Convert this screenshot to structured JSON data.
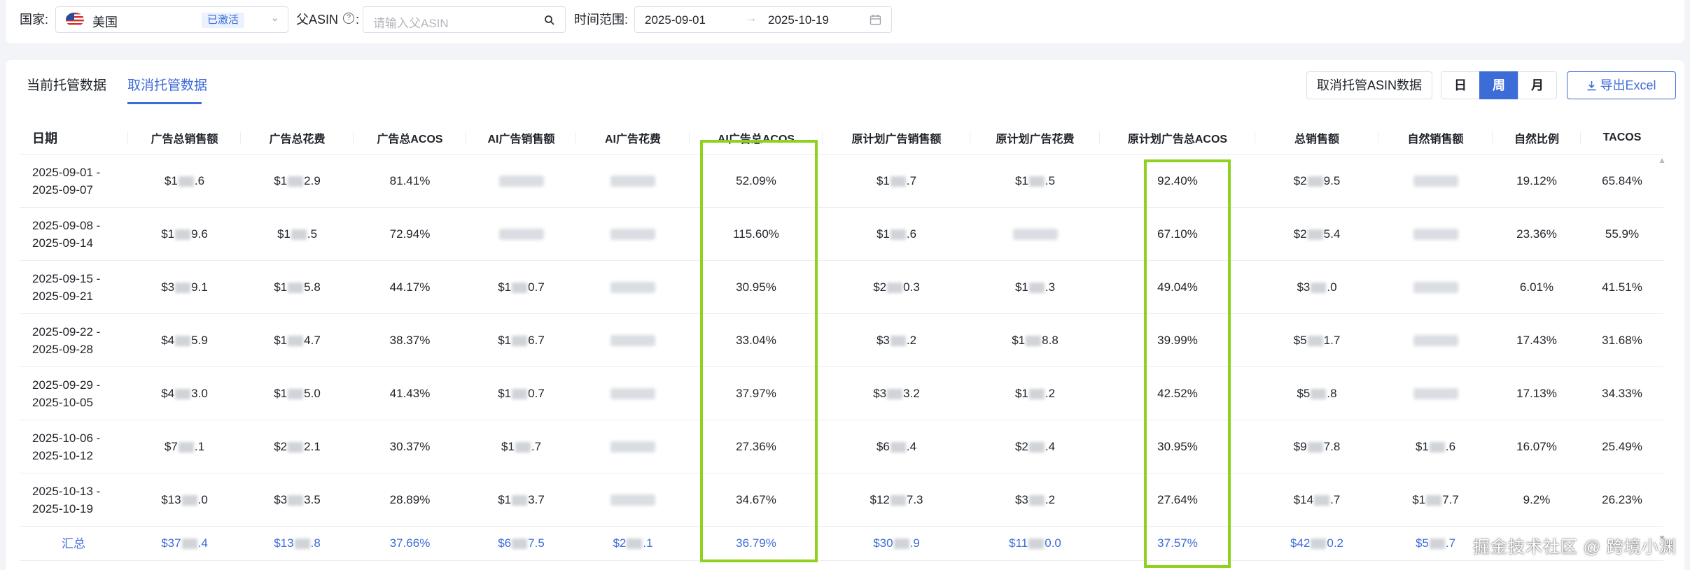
{
  "filters": {
    "country_label": "国家:",
    "country_value": "美国",
    "country_badge": "已激活",
    "parent_asin_label": "父ASIN",
    "parent_asin_placeholder": "请输入父ASIN",
    "date_range_label": "时间范围:",
    "date_start": "2025-09-01",
    "date_end": "2025-10-19"
  },
  "tabs": [
    "当前托管数据",
    "取消托管数据"
  ],
  "actions": {
    "cancel_asin_data": "取消托管ASIN数据",
    "period_day": "日",
    "period_week": "周",
    "period_month": "月",
    "export": "导出Excel"
  },
  "table": {
    "columns": [
      "日期",
      "广告总销售额",
      "广告总花费",
      "广告总ACOS",
      "AI广告销售额",
      "AI广告花费",
      "AI广告总ACOS",
      "原计划广告销售额",
      "原计划广告花费",
      "原计划广告总ACOS",
      "总销售额",
      "自然销售额",
      "自然比例",
      "TACOS"
    ],
    "rows": [
      {
        "date1": "2025-09-01 -",
        "date2": "2025-09-07",
        "c1a": "$1",
        "c1b": ".6",
        "c2a": "$1",
        "c2b": "2.9",
        "acos": "81.41%",
        "c4a": "",
        "c4b": "",
        "c5a": "",
        "c5b": "",
        "ai_acos": "52.09%",
        "c7a": "$1",
        "c7b": ".7",
        "c8a": "$1",
        "c8b": ".5",
        "orig_acos": "92.40%",
        "c10a": "$2",
        "c10b": "9.5",
        "c11a": "",
        "c11b": "",
        "ratio": "19.12%",
        "tacos": "65.84%"
      },
      {
        "date1": "2025-09-08 -",
        "date2": "2025-09-14",
        "c1a": "$1",
        "c1b": "9.6",
        "c2a": "$1",
        "c2b": ".5",
        "acos": "72.94%",
        "c4a": "",
        "c4b": "",
        "c5a": "",
        "c5b": "",
        "ai_acos": "115.60%",
        "c7a": "$1",
        "c7b": ".6",
        "c8a": "",
        "c8b": "",
        "orig_acos": "67.10%",
        "c10a": "$2",
        "c10b": "5.4",
        "c11a": "",
        "c11b": "",
        "ratio": "23.36%",
        "tacos": "55.9%"
      },
      {
        "date1": "2025-09-15 -",
        "date2": "2025-09-21",
        "c1a": "$3",
        "c1b": "9.1",
        "c2a": "$1",
        "c2b": "5.8",
        "acos": "44.17%",
        "c4a": "$1",
        "c4b": "0.7",
        "c5a": "",
        "c5b": "",
        "ai_acos": "30.95%",
        "c7a": "$2",
        "c7b": "0.3",
        "c8a": "$1",
        "c8b": ".3",
        "orig_acos": "49.04%",
        "c10a": "$3",
        "c10b": ".0",
        "c11a": "",
        "c11b": "",
        "ratio": "6.01%",
        "tacos": "41.51%"
      },
      {
        "date1": "2025-09-22 -",
        "date2": "2025-09-28",
        "c1a": "$4",
        "c1b": "5.9",
        "c2a": "$1",
        "c2b": "4.7",
        "acos": "38.37%",
        "c4a": "$1",
        "c4b": "6.7",
        "c5a": "",
        "c5b": "",
        "ai_acos": "33.04%",
        "c7a": "$3",
        "c7b": ".2",
        "c8a": "$1",
        "c8b": "8.8",
        "orig_acos": "39.99%",
        "c10a": "$5",
        "c10b": "1.7",
        "c11a": "",
        "c11b": "",
        "ratio": "17.43%",
        "tacos": "31.68%"
      },
      {
        "date1": "2025-09-29 -",
        "date2": "2025-10-05",
        "c1a": "$4",
        "c1b": "3.0",
        "c2a": "$1",
        "c2b": "5.0",
        "acos": "41.43%",
        "c4a": "$1",
        "c4b": "0.7",
        "c5a": "",
        "c5b": "",
        "ai_acos": "37.97%",
        "c7a": "$3",
        "c7b": "3.2",
        "c8a": "$1",
        "c8b": ".2",
        "orig_acos": "42.52%",
        "c10a": "$5",
        "c10b": ".8",
        "c11a": "",
        "c11b": "",
        "ratio": "17.13%",
        "tacos": "34.33%"
      },
      {
        "date1": "2025-10-06 -",
        "date2": "2025-10-12",
        "c1a": "$7",
        "c1b": ".1",
        "c2a": "$2",
        "c2b": "2.1",
        "acos": "30.37%",
        "c4a": "$1",
        "c4b": ".7",
        "c5a": "",
        "c5b": "",
        "ai_acos": "27.36%",
        "c7a": "$6",
        "c7b": ".4",
        "c8a": "$2",
        "c8b": ".4",
        "orig_acos": "30.95%",
        "c10a": "$9",
        "c10b": "7.8",
        "c11a": "$1",
        "c11b": ".6",
        "ratio": "16.07%",
        "tacos": "25.49%"
      },
      {
        "date1": "2025-10-13 -",
        "date2": "2025-10-19",
        "c1a": "$13",
        "c1b": ".0",
        "c2a": "$3",
        "c2b": "3.5",
        "acos": "28.89%",
        "c4a": "$1",
        "c4b": "3.7",
        "c5a": "",
        "c5b": "",
        "ai_acos": "34.67%",
        "c7a": "$12",
        "c7b": "7.3",
        "c8a": "$3",
        "c8b": ".2",
        "orig_acos": "27.64%",
        "c10a": "$14",
        "c10b": ".7",
        "c11a": "$1",
        "c11b": "7.7",
        "ratio": "9.2%",
        "tacos": "26.23%"
      }
    ],
    "total": {
      "label": "汇总",
      "c1a": "$37",
      "c1b": ".4",
      "c2a": "$13",
      "c2b": ".8",
      "acos": "37.66%",
      "c4a": "$6",
      "c4b": "7.5",
      "c5a": "$2",
      "c5b": ".1",
      "ai_acos": "36.79%",
      "c7a": "$30",
      "c7b": ".9",
      "c8a": "$11",
      "c8b": "0.0",
      "orig_acos": "37.57%",
      "c10a": "$42",
      "c10b": "0.2",
      "c11a": "$5",
      "c11b": ".7"
    }
  },
  "watermark": "掘金技术社区 @ 跨境小渊",
  "colors": {
    "accent": "#3d6bd8",
    "highlight_box": "#8fd11f"
  }
}
